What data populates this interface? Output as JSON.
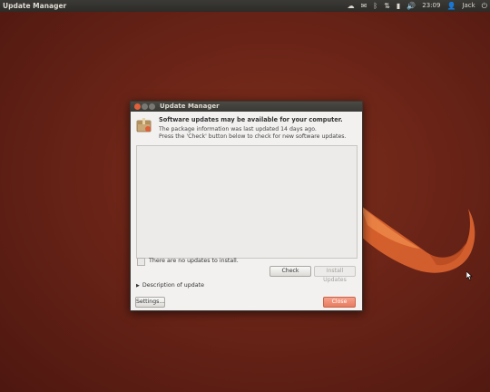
{
  "panel": {
    "app_name": "Update Manager",
    "time": "23:09",
    "user": "Jack",
    "icons": [
      "cloud-icon",
      "mail-icon",
      "bluetooth-icon",
      "network-icon",
      "battery-icon",
      "volume-icon",
      "user-icon",
      "power-icon"
    ]
  },
  "window": {
    "title": "Update Manager",
    "headline": "Software updates may be available for your computer.",
    "info_line1": "The package information was last updated 14 days ago.",
    "info_line2": "Press the 'Check' button below to check for new software updates.",
    "no_updates": "There are no updates to install.",
    "check_label": "Check",
    "install_label": "Install Updates",
    "description_label": "Description of update",
    "settings_label": "Settings...",
    "close_label": "Close"
  },
  "colors": {
    "accent": "#e77c5f",
    "desktop": "#6a2417",
    "panel": "#3b3a36"
  }
}
